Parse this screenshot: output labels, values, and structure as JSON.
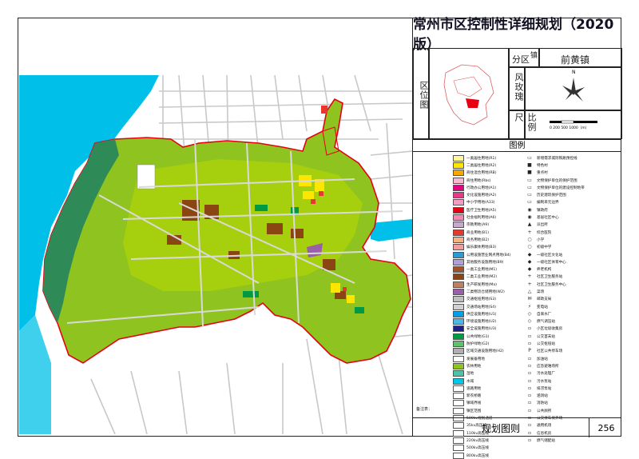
{
  "title": "常州市区控制性详细规划（2020版）",
  "district_label_a": "分区",
  "district_label_b": "镇",
  "town_name": "前黄镇",
  "location_map_label": "区位图",
  "wind_rose_label": "风玫瑰",
  "scale_label": "比例尺",
  "north_label": "N",
  "scale_text": "0   200 500    1000（m）",
  "legend_title": "图例",
  "legend_left": [
    {
      "label": "一类居住用地(R1)",
      "color": "#fff799"
    },
    {
      "label": "二类居住用地(R2)",
      "color": "#ffe600"
    },
    {
      "label": "商住混合用地(RB)",
      "color": "#f7a600"
    },
    {
      "label": "商住用地(Rbs)",
      "color": "#f9b7d0"
    },
    {
      "label": "行政办公用地(A1)",
      "color": "#e4007f"
    },
    {
      "label": "文化设施用地(A2)",
      "color": "#e8388a"
    },
    {
      "label": "中小学用地(A33)",
      "color": "#f59bc2"
    },
    {
      "label": "医疗卫生用地(A5)",
      "color": "#e60012"
    },
    {
      "label": "社会福利用地(A6)",
      "color": "#f08ab0"
    },
    {
      "label": "宗教用地(A9)",
      "color": "#c7a8d0"
    },
    {
      "label": "商业用地(B1)",
      "color": "#e8382d"
    },
    {
      "label": "商务用地(B2)",
      "color": "#f4b183"
    },
    {
      "label": "娱乐康体用地(B3)",
      "color": "#f29c9f"
    },
    {
      "label": "公用设施营业网点用地(B4)",
      "color": "#2b9bd8"
    },
    {
      "label": "其他服务设施用地(B9)",
      "color": "#b0a0d8"
    },
    {
      "label": "一类工业用地(M1)",
      "color": "#a0522d"
    },
    {
      "label": "二类工业用地(M2)",
      "color": "#8b4513"
    },
    {
      "label": "生产研发用地(Ma)",
      "color": "#c08060"
    },
    {
      "label": "二类物流仓储用地(W2)",
      "color": "#9a5fa8"
    },
    {
      "label": "交通枢纽用地(S3)",
      "color": "#bfbfbf"
    },
    {
      "label": "交通场站用地(S4)",
      "color": "#d0d0d0"
    },
    {
      "label": "供应设施用地(U1)",
      "color": "#00a0e9"
    },
    {
      "label": "环境设施用地(U2)",
      "color": "#4db8e8"
    },
    {
      "label": "安全设施用地(U3)",
      "color": "#1d2088"
    },
    {
      "label": "公共绿地(G1)",
      "color": "#009944"
    },
    {
      "label": "防护绿地(G2)",
      "color": "#5ec26a"
    },
    {
      "label": "区域交通设施用地(H2)",
      "color": "#b0b0b0"
    },
    {
      "label": "发展备用地",
      "color": "#ffffff"
    },
    {
      "label": "农林用地",
      "color": "#8fc31f"
    },
    {
      "label": "湿地",
      "color": "#4fc1a6"
    },
    {
      "label": "水域",
      "color": "#00c8e8"
    },
    {
      "label": "道路用地",
      "color": "#ffffff"
    },
    {
      "label": "新农桥路",
      "color": "#ffffff"
    },
    {
      "label": "镇域界线",
      "color": "#ffffff"
    },
    {
      "label": "镇区范围",
      "color": "#ffffff"
    },
    {
      "label": "500kv规划通道",
      "color": "#ffffff"
    },
    {
      "label": "35kv高压线",
      "color": "#ffffff"
    },
    {
      "label": "110kv高压线",
      "color": "#ffffff"
    },
    {
      "label": "220kv高压线",
      "color": "#ffffff"
    },
    {
      "label": "500kv高压线",
      "color": "#ffffff"
    },
    {
      "label": "800kv高压线",
      "color": "#ffffff"
    }
  ],
  "legend_right": [
    {
      "label": "新增需求城际铁路预控线",
      "icon": "▭"
    },
    {
      "label": "特色村",
      "icon": "■"
    },
    {
      "label": "重点村",
      "icon": "■"
    },
    {
      "label": "文物保护单位的保护范围",
      "icon": "▭"
    },
    {
      "label": "文物保护单位的建设控制地带",
      "icon": "▭"
    },
    {
      "label": "历史建筑保护范围",
      "icon": "▭"
    },
    {
      "label": "编制单元边界",
      "icon": "▭"
    },
    {
      "label": "镇政府",
      "icon": "◉"
    },
    {
      "label": "基层社区中心",
      "icon": "◉"
    },
    {
      "label": "派出所",
      "icon": "▲"
    },
    {
      "label": "综合医院",
      "icon": "+"
    },
    {
      "label": "小学",
      "icon": "○"
    },
    {
      "label": "初级中学",
      "icon": "○"
    },
    {
      "label": "一级社区文化站",
      "icon": "◆"
    },
    {
      "label": "一级社区体育中心",
      "icon": "◆"
    },
    {
      "label": "养老机构",
      "icon": "◆"
    },
    {
      "label": "社区卫生服务站",
      "icon": "+"
    },
    {
      "label": "社区卫生服务中心",
      "icon": "+"
    },
    {
      "label": "菜场",
      "icon": "△"
    },
    {
      "label": "邮政支局",
      "icon": "✉"
    },
    {
      "label": "变电站",
      "icon": "⚡"
    },
    {
      "label": "自来水厂",
      "icon": "◇"
    },
    {
      "label": "燃气调压站",
      "icon": "◇"
    },
    {
      "label": "小区垃圾收集房",
      "icon": "▫"
    },
    {
      "label": "公交首末站",
      "icon": "▫"
    },
    {
      "label": "公交枢纽站",
      "icon": "▫"
    },
    {
      "label": "社区公共停车场",
      "icon": "P"
    },
    {
      "label": "加油站",
      "icon": "▫"
    },
    {
      "label": "应急避难场所",
      "icon": "▫"
    },
    {
      "label": "污水处理厂",
      "icon": "▫"
    },
    {
      "label": "污水泵站",
      "icon": "▫"
    },
    {
      "label": "排涝泵站",
      "icon": "▫"
    },
    {
      "label": "涵洞站",
      "icon": "▫"
    },
    {
      "label": "消防站",
      "icon": "▫"
    },
    {
      "label": "公共厕所",
      "icon": "▫"
    },
    {
      "label": "公交停车保养场",
      "icon": "▫"
    },
    {
      "label": "通用机场",
      "icon": "▫"
    },
    {
      "label": "信息机房",
      "icon": "▫"
    },
    {
      "label": "燃气储配站",
      "icon": "▫"
    }
  ],
  "legend_note": "备注表：",
  "footer_title": "规划图则",
  "page_number": "256",
  "colors": {
    "water": "#00bfe8",
    "farmland": "#8fc31f",
    "forest": "#2e8b57",
    "boundary": "#e60012",
    "road_grey": "#b5b5b5",
    "industry": "#8b4513",
    "residential": "#ffe600"
  }
}
